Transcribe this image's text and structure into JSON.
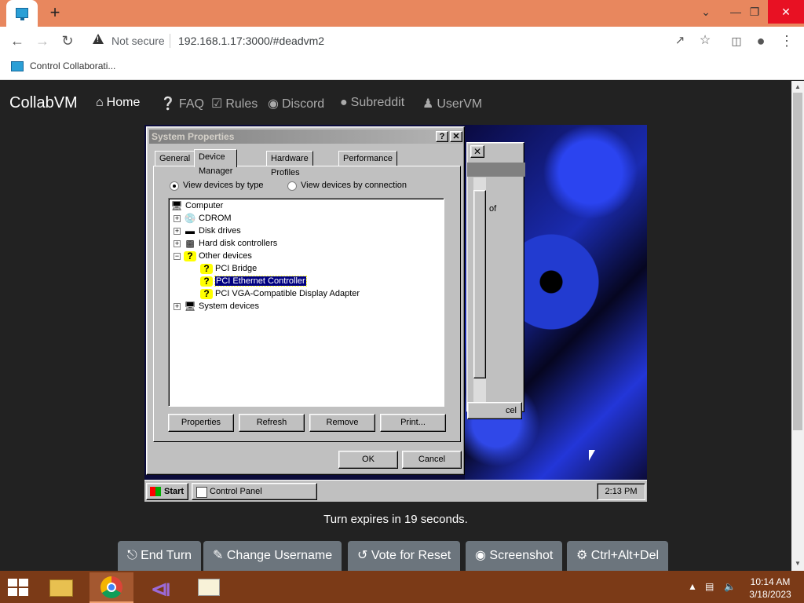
{
  "browser": {
    "new_tab_glyph": "+",
    "security_label": "Not secure",
    "url": "192.168.1.17:3000/#deadvm2",
    "bookmark": "Control Collaborati..."
  },
  "site": {
    "brand": "CollabVM",
    "nav": [
      {
        "label": "Home",
        "icon": "home-icon"
      },
      {
        "label": "FAQ",
        "icon": "question-icon"
      },
      {
        "label": "Rules",
        "icon": "clipboard-check-icon"
      },
      {
        "label": "Discord",
        "icon": "discord-icon"
      },
      {
        "label": "Subreddit",
        "icon": "reddit-icon"
      },
      {
        "label": "UserVM",
        "icon": "user-icon"
      }
    ],
    "turn_status": "Turn expires in 19 seconds.",
    "actions": [
      {
        "label": "End Turn",
        "icon": "mouse-icon"
      },
      {
        "label": "Change Username",
        "icon": "user-pen-icon"
      },
      {
        "label": "Vote for Reset",
        "icon": "undo-icon"
      },
      {
        "label": "Screenshot",
        "icon": "camera-icon"
      },
      {
        "label": "Ctrl+Alt+Del",
        "icon": "gear-icon"
      }
    ]
  },
  "vm": {
    "background_window": {
      "text": "of",
      "button": "cel"
    },
    "dialog": {
      "title": "System Properties",
      "tabs": [
        "General",
        "Device Manager",
        "Hardware Profiles",
        "Performance"
      ],
      "active_tab": "Device Manager",
      "view_options": [
        "View devices by type",
        "View devices by connection"
      ],
      "selected_view": "View devices by type",
      "tree": [
        {
          "label": "Computer",
          "level": 0,
          "expander": "",
          "icon": "computer-icon"
        },
        {
          "label": "CDROM",
          "level": 1,
          "expander": "+",
          "icon": "cdrom-icon"
        },
        {
          "label": "Disk drives",
          "level": 1,
          "expander": "+",
          "icon": "disk-icon"
        },
        {
          "label": "Hard disk controllers",
          "level": 1,
          "expander": "+",
          "icon": "controller-icon"
        },
        {
          "label": "Other devices",
          "level": 1,
          "expander": "−",
          "icon": "question-icon"
        },
        {
          "label": "PCI Bridge",
          "level": 2,
          "expander": "",
          "icon": "unknown-device-icon"
        },
        {
          "label": "PCI Ethernet Controller",
          "level": 2,
          "expander": "",
          "icon": "unknown-device-icon",
          "selected": true
        },
        {
          "label": "PCI VGA-Compatible Display Adapter",
          "level": 2,
          "expander": "",
          "icon": "unknown-device-icon"
        },
        {
          "label": "System devices",
          "level": 1,
          "expander": "+",
          "icon": "system-icon"
        }
      ],
      "buttons": [
        "Properties",
        "Refresh",
        "Remove",
        "Print..."
      ],
      "ok": "OK",
      "cancel": "Cancel"
    },
    "taskbar": {
      "start": "Start",
      "task": "Control Panel",
      "clock": "2:13 PM"
    }
  },
  "windows_taskbar": {
    "time": "10:14 AM",
    "date": "3/18/2023",
    "pinned": [
      "file-explorer-icon",
      "chrome-icon",
      "visual-studio-icon",
      "certificate-app-icon"
    ]
  }
}
